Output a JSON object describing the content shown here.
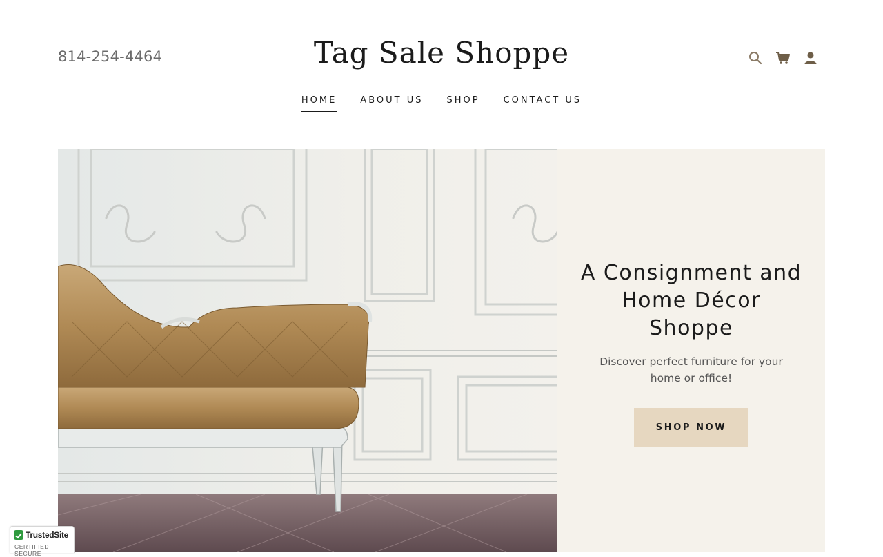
{
  "header": {
    "phone": "814-254-4464",
    "site_title": "Tag Sale Shoppe",
    "icons": [
      "search-icon",
      "cart-icon",
      "account-icon"
    ]
  },
  "nav": {
    "items": [
      {
        "label": "HOME",
        "active": true
      },
      {
        "label": "ABOUT US",
        "active": false
      },
      {
        "label": "SHOP",
        "active": false
      },
      {
        "label": "CONTACT US",
        "active": false
      }
    ]
  },
  "hero": {
    "heading": "A Consignment and Home Décor Shoppe",
    "subtext": "Discover perfect furniture for your home or office!",
    "button_label": "SHOP NOW",
    "panel_color": "#f5f2eb",
    "button_color": "#e6d7c0"
  },
  "badge": {
    "title": "TrustedSite",
    "subtitle": "CERTIFIED SECURE"
  }
}
